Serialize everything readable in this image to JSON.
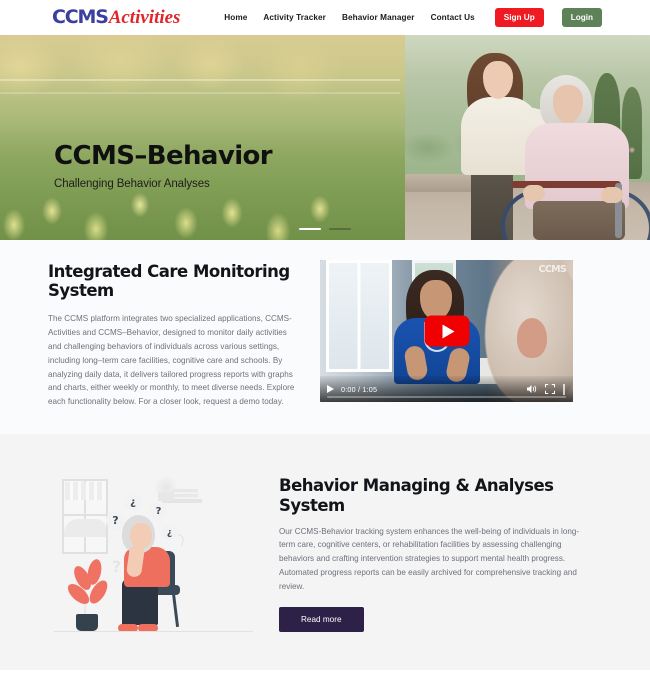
{
  "header": {
    "logo_primary": "CCMS",
    "logo_secondary": "Activities",
    "nav": [
      {
        "label": "Home"
      },
      {
        "label": "Activity Tracker"
      },
      {
        "label": "Behavior Manager"
      },
      {
        "label": "Contact Us"
      }
    ],
    "signup_label": "Sign Up",
    "login_label": "Login",
    "signup_color": "#ef1b22",
    "login_color": "#5e8257",
    "logo_primary_color": "#3b3f9e",
    "logo_secondary_color": "#e0252b"
  },
  "hero": {
    "title": "CCMS–Behavior",
    "subtitle": "Challenging Behavior Analyses",
    "slides": [
      {
        "state": "active"
      },
      {
        "state": "idle"
      }
    ],
    "image_alt": "caregiver-with-elderly-woman-in-wheelchair-in-garden"
  },
  "section_monitoring": {
    "title": "Integrated Care Monitoring System",
    "body": "The CCMS platform integrates two specialized applications, CCMS-Activities and CCMS–Behavior, designed to monitor daily activities and challenging behaviors of individuals across various settings, including long–term care facilities, cognitive care and schools. By analyzing daily data, it delivers tailored progress reports with graphs and charts, either weekly or monthly, to meet diverse needs. Explore each functionality below. For a closer look, request a demo today.",
    "video": {
      "watermark": "CCMS",
      "time": "0:00 / 1:05",
      "play_label": "Play",
      "mute_label": "Mute",
      "fullscreen_label": "Full screen",
      "more_label": "More options",
      "thumbnail_alt": "nurse-speaking-with-elderly-patient"
    }
  },
  "section_behavior": {
    "title": "Behavior Managing & Analyses System",
    "body": "Our CCMS-Behavior tracking system enhances the well-being of individuals in long-term care, cognitive centers, or rehabilitation facilities by assessing challenging behaviors and crafting intervention strategies to support mental health progress. Automated progress reports can be easily archived for comprehensive tracking and review.",
    "button_label": "Read more",
    "button_color": "#2e2147",
    "illustration_alt": "elderly-person-sitting-on-chair-with-question-mark-thought-bubbles",
    "bubbles": [
      "¿",
      "?",
      "?",
      "¿"
    ],
    "loose_question": "?",
    "background_color": "#f4f4f4"
  }
}
